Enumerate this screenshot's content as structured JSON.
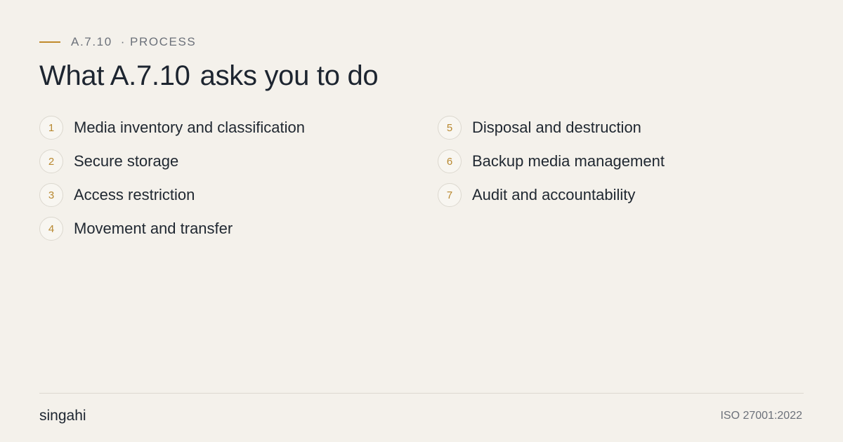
{
  "header": {
    "code": "A.7.10",
    "separator": "·",
    "category": "PROCESS",
    "title_prefix": "What A.7.10",
    "title_suffix": "asks you to do"
  },
  "items_left": [
    {
      "number": "1",
      "label": "Media inventory and classification"
    },
    {
      "number": "2",
      "label": "Secure storage"
    },
    {
      "number": "3",
      "label": "Access restriction"
    },
    {
      "number": "4",
      "label": "Movement and transfer"
    }
  ],
  "items_right": [
    {
      "number": "5",
      "label": "Disposal and destruction"
    },
    {
      "number": "6",
      "label": "Backup media management"
    },
    {
      "number": "7",
      "label": "Audit and accountability"
    }
  ],
  "footer": {
    "brand": "singahi",
    "standard": "ISO 27001:2022"
  },
  "colors": {
    "background": "#f4f1eb",
    "accent": "#c08a2c",
    "text": "#1f2730",
    "muted": "#6c717a"
  }
}
